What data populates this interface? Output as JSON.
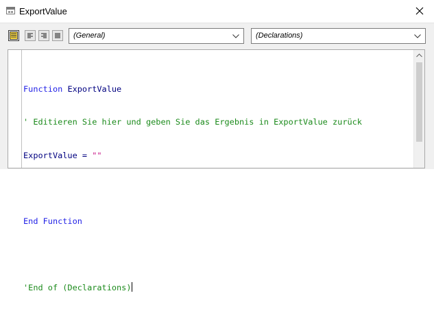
{
  "window": {
    "title": "ExportValue"
  },
  "toolbar": {
    "procedure_combo": "(General)",
    "declarations_combo": "(Declarations)"
  },
  "code": {
    "line1_kw": "Function",
    "line1_name": " ExportValue",
    "line2_comment": "' Editieren Sie hier und geben Sie das Ergebnis in ExportValue zurück",
    "line3_lhs": "ExportValue = ",
    "line3_str": "\"\"",
    "line5_kw": "End Function",
    "line7_comment": "'End of (Declarations)"
  },
  "colors": {
    "keyword": "#1e1ee6",
    "comment": "#1b8a1b",
    "string": "#c71585"
  }
}
